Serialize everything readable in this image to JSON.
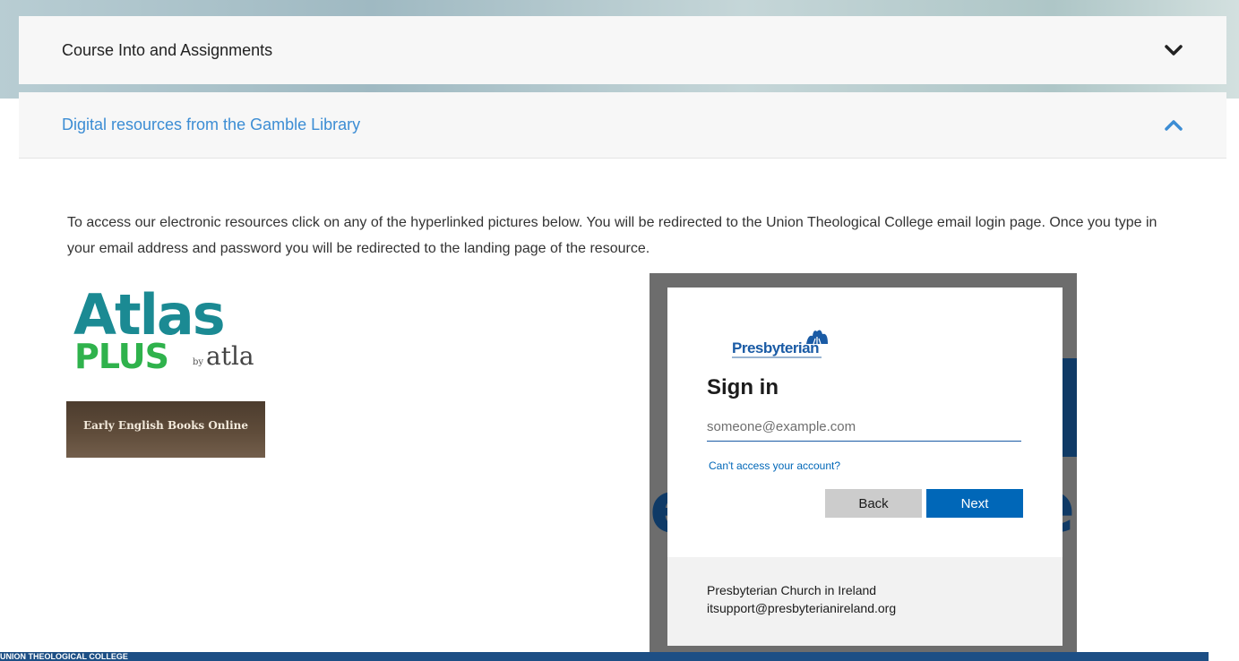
{
  "accordion": {
    "items": [
      {
        "title": "Course Into and Assignments",
        "state": "collapsed",
        "chevron": "chevron-down-icon"
      },
      {
        "title": "Digital resources from the Gamble Library",
        "state": "expanded",
        "chevron": "chevron-up-icon"
      }
    ]
  },
  "panel": {
    "intro": "To access our electronic resources click on any of the hyperlinked pictures below. You will be redirected to the Union Theological College email login page. Once you type in your email address and password you will be redirected to the landing page of the resource.",
    "resources": [
      {
        "name": "Atlas PLUS",
        "logo_main": "Atlas",
        "logo_plus": "PLUS",
        "logo_by": "by",
        "logo_org": "atla"
      },
      {
        "name": "Early English Books Online",
        "title": "Early English Books Online"
      }
    ]
  },
  "login": {
    "logo_text": "Presbyterian",
    "title": "Sign in",
    "email_placeholder": "someone@example.com",
    "cant_access": "Can't access your account?",
    "back_label": "Back",
    "next_label": "Next",
    "footer_line1": "Presbyterian Church in Ireland",
    "footer_line2": "itsupport@presbyterianireland.org"
  },
  "footer": {
    "label": "UNION THEOLOGICAL COLLEGE"
  },
  "colors": {
    "link_blue": "#3c8dd4",
    "ms_blue": "#0067b8",
    "atlas_teal": "#1b8a93",
    "atlas_green": "#2fb24c",
    "footer_navy": "#1d4f85"
  }
}
